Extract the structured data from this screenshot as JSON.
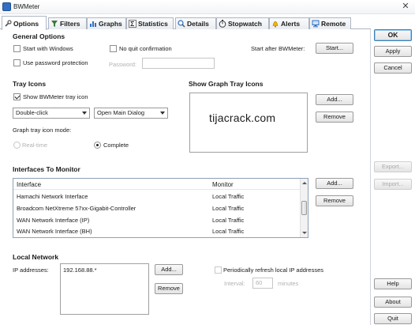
{
  "window": {
    "title": "BWMeter",
    "close_glyph": "✕"
  },
  "tabs": [
    {
      "label": "Options",
      "icon": "wrench-icon",
      "active": true
    },
    {
      "label": "Filters",
      "icon": "filter-icon",
      "active": false
    },
    {
      "label": "Graphs",
      "icon": "graph-icon",
      "active": false
    },
    {
      "label": "Statistics",
      "icon": "sigma-icon",
      "active": false
    },
    {
      "label": "Details",
      "icon": "magnifier-icon",
      "active": false
    },
    {
      "label": "Stopwatch",
      "icon": "stopwatch-icon",
      "active": false
    },
    {
      "label": "Alerts",
      "icon": "bell-icon",
      "active": false
    },
    {
      "label": "Remote",
      "icon": "remote-icon",
      "active": false
    }
  ],
  "general": {
    "title": "General Options",
    "start_with_windows": {
      "label": "Start with Windows",
      "checked": false
    },
    "no_quit_confirmation": {
      "label": "No quit confirmation",
      "checked": false
    },
    "use_password": {
      "label": "Use password protection",
      "checked": false
    },
    "password_label": "Password:",
    "password_value": "",
    "start_after_label": "Start after BWMeter:",
    "start_button": "Start..."
  },
  "tray": {
    "title": "Tray Icons",
    "show_tray_icon": {
      "label": "Show BWMeter tray icon",
      "checked": true
    },
    "click_action": "Double-click",
    "click_result": "Open Main Dialog",
    "mode_label": "Graph tray icon mode:",
    "mode_realtime": "Real-time",
    "mode_complete": "Complete",
    "mode_selected": "Complete"
  },
  "graph_tray": {
    "title": "Show Graph Tray Icons",
    "watermark": "tijacrack.com",
    "add_button": "Add...",
    "remove_button": "Remove"
  },
  "interfaces": {
    "title": "Interfaces To Monitor",
    "columns": [
      "Interface",
      "Monitor"
    ],
    "rows": [
      {
        "name": "Hamachi Network Interface",
        "monitor": "Local Traffic"
      },
      {
        "name": "Broadcom NetXtreme 57xx-Gigabit-Controller",
        "monitor": "Local Traffic"
      },
      {
        "name": "WAN Network Interface (IP)",
        "monitor": "Local Traffic"
      },
      {
        "name": "WAN Network Interface (BH)",
        "monitor": "Local Traffic"
      }
    ],
    "add_button": "Add...",
    "remove_button": "Remove"
  },
  "local_network": {
    "title": "Local Network",
    "ip_label": "IP addresses:",
    "ip_values": [
      "192.168.88.*"
    ],
    "add_button": "Add...",
    "remove_button": "Remove",
    "refresh": {
      "label": "Periodically refresh local IP addresses",
      "checked": false
    },
    "interval_label": "Interval:",
    "interval_value": "60",
    "interval_unit": "minutes"
  },
  "side_buttons": {
    "ok": "OK",
    "apply": "Apply",
    "cancel": "Cancel",
    "export": "Export...",
    "import": "Import...",
    "help": "Help",
    "about": "About",
    "quit": "Quit"
  },
  "colors": {
    "accent": "#3c7fb1",
    "check": "#222222",
    "border": "#9a9a9a"
  }
}
